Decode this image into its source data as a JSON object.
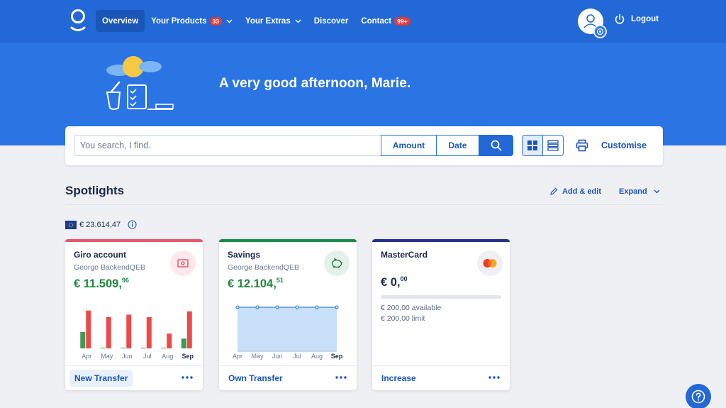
{
  "nav": {
    "items": [
      {
        "label": "Overview",
        "active": true
      },
      {
        "label": "Your Products",
        "badge": "33",
        "dropdown": true
      },
      {
        "label": "Your Extras",
        "dropdown": true
      },
      {
        "label": "Discover"
      },
      {
        "label": "Contact",
        "badge": "99+"
      }
    ],
    "logout": "Logout"
  },
  "hero": {
    "greeting": "A very good afternoon, Marie."
  },
  "search": {
    "placeholder": "You search, I find.",
    "amount": "Amount",
    "date": "Date",
    "customise": "Customise"
  },
  "spotlights": {
    "title": "Spotlights",
    "add_edit": "Add & edit",
    "expand": "Expand",
    "total": "€ 23.614,47"
  },
  "cards": [
    {
      "name": "Giro account",
      "owner": "George BackendQEB",
      "balance_main": "€ 11.509,",
      "balance_cents": "96",
      "action": "New Transfer",
      "accent": "#e8566c"
    },
    {
      "name": "Savings",
      "owner": "George BackendQEB",
      "balance_main": "€ 12.104,",
      "balance_cents": "51",
      "action": "Own Transfer",
      "accent": "#1a8a4a"
    },
    {
      "name": "MasterCard",
      "balance_main": "€ 0,",
      "balance_cents": "00",
      "available": "€ 200,00 available",
      "limit": "€ 200,00 limit",
      "action": "Increase",
      "accent": "#2a2f8c"
    }
  ],
  "chart_data": [
    {
      "type": "bar",
      "categories": [
        "Apr",
        "May",
        "Jun",
        "Jul",
        "Aug",
        "Sep"
      ],
      "series": [
        {
          "values": [
            20,
            0,
            0,
            0,
            0,
            12
          ]
        },
        {
          "values": [
            46,
            38,
            41,
            38,
            18,
            45
          ]
        }
      ],
      "ylim": [
        0,
        50
      ]
    },
    {
      "type": "area",
      "categories": [
        "Apr",
        "May",
        "Jun",
        "Jul",
        "Aug",
        "Sep"
      ],
      "values": [
        100,
        100,
        100,
        100,
        100,
        100
      ],
      "ylim": [
        0,
        100
      ]
    }
  ],
  "colors": {
    "primary": "#2268d6",
    "income": "#3f9a55",
    "expense": "#ec4a4a",
    "positive_balance": "#1f8a3a"
  }
}
